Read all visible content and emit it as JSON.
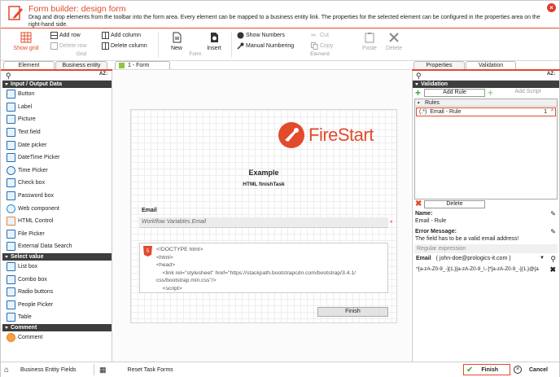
{
  "window": {
    "title": "Form builder: design form",
    "subtitle": "Drag and drop elements from the toolbar into the form area. Every element can be mapped to a business entity link. The properties for the selected element can be configured in the properties area on the right-hand side."
  },
  "ribbon": {
    "show_grid": "Show grid",
    "add_row": "Add row",
    "delete_row": "Delete row",
    "add_column": "Add column",
    "delete_column": "Delete column",
    "grid_group": "Grid",
    "new": "New",
    "insert": "Insert",
    "form_group": "Form",
    "show_numbers": "Show Numbers",
    "manual_numbering": "Manual Numbering",
    "cut": "Cut",
    "copy": "Copy",
    "paste": "Paste",
    "delete": "Delete",
    "element_group": "Element"
  },
  "tabs": {
    "element": "Element",
    "business_entity": "Business entity",
    "form_tab": "1 - Form",
    "properties": "Properties",
    "validation": "Validation"
  },
  "left": {
    "sections": [
      {
        "title": "Input / Output Data",
        "items": [
          "Button",
          "Label",
          "Picture",
          "Text field",
          "Date picker",
          "DateTime Picker",
          "Time Picker",
          "Check box",
          "Password box",
          "Web component",
          "HTML Control",
          "File Picker",
          "External Data Search"
        ]
      },
      {
        "title": "Select value",
        "items": [
          "List box",
          "Combo box",
          "Radio buttons",
          "People Picker",
          "Table"
        ]
      },
      {
        "title": "Comment",
        "items": [
          "Comment"
        ]
      }
    ]
  },
  "form": {
    "logo_text": "FireStart",
    "heading": "Example",
    "subheading": "HTML finishTask",
    "email_label": "Email",
    "email_value": "Workflow Variables.Email",
    "code": [
      "<!DOCTYPE html>",
      "<html>",
      "<head>",
      "    <link rel=\"stylesheet\" href=\"https://stackpath.bootstrapcdn.com/bootstrap/3.4.1/",
      "css/bootstrap.min.css\"/>",
      "    <script>"
    ],
    "finish_button": "Finish"
  },
  "right": {
    "section": "Validation",
    "add_rule": "Add Rule",
    "add_script": "Add Script",
    "rules_header": "Rules",
    "rule_item": "(.*)  Email - Rule",
    "rule_num": "1",
    "delete": "Delete",
    "name_label": "Name:",
    "name_value": "Email - Rule",
    "error_label": "Error Message:",
    "error_value": "The field has to be a valid email address!",
    "regex_header": "Regular expression",
    "regex_field": "Email",
    "regex_hint": "( john-doe@prologics-it.com )",
    "regex_value": "^[a-zA-Z0-9_-]{1,}[a-zA-Z0-9_\\.-]*[a-zA-Z0-9_-]{1,}@[a"
  },
  "bottom": {
    "business_entity_fields": "Business Entity Fields",
    "reset_task_forms": "Reset Task Forms",
    "finish": "Finish",
    "cancel": "Cancel"
  },
  "colors": {
    "accent": "#e24a2c",
    "green": "#3aa635",
    "blue": "#1f6fb5"
  }
}
